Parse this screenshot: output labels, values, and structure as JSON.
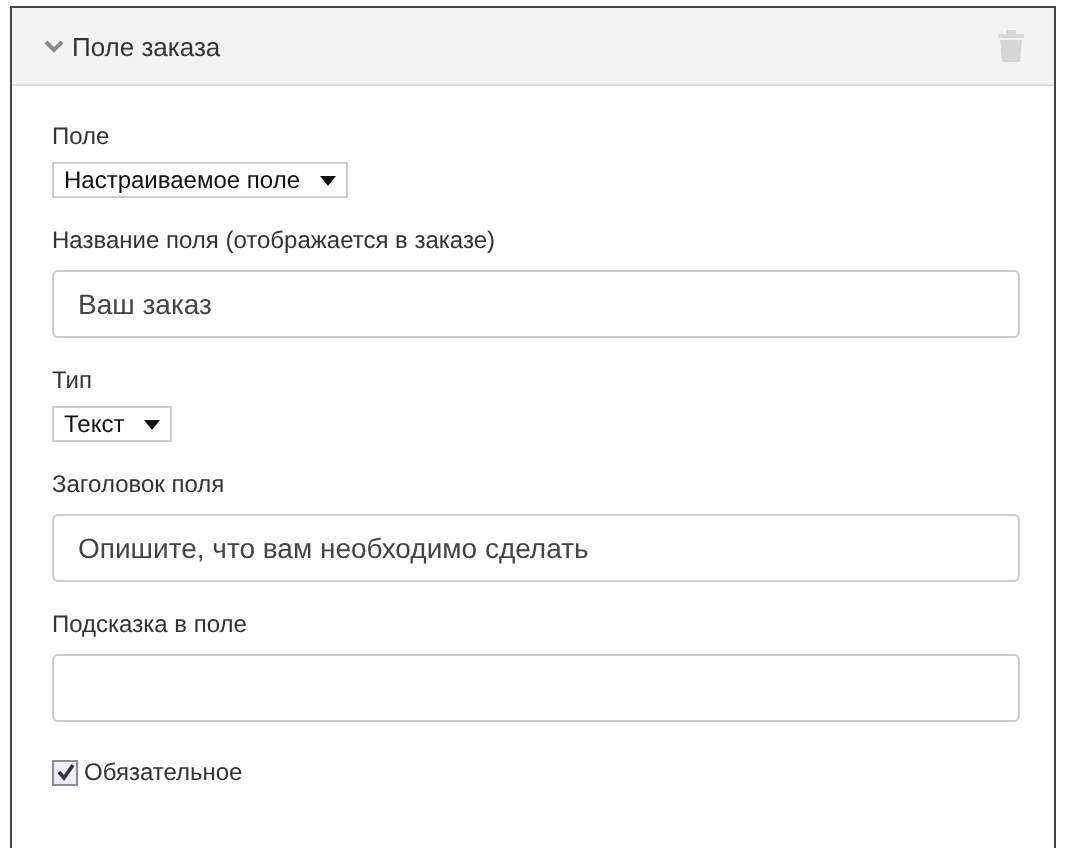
{
  "panel": {
    "title": "Поле заказа",
    "expanded": true
  },
  "fields": [
    {
      "kind": "select",
      "label": "Поле",
      "value": "Настраиваемое поле"
    },
    {
      "kind": "text",
      "label": "Название поля (отображается в заказе)",
      "value": "Ваш заказ"
    },
    {
      "kind": "select",
      "label": "Тип",
      "value": "Текст"
    },
    {
      "kind": "text",
      "label": "Заголовок поля",
      "value": "Опишите, что вам необходимо сделать"
    },
    {
      "kind": "text",
      "label": "Подсказка в поле"
    },
    {
      "kind": "checkbox",
      "label": "Обязательное",
      "checked": true
    }
  ]
}
